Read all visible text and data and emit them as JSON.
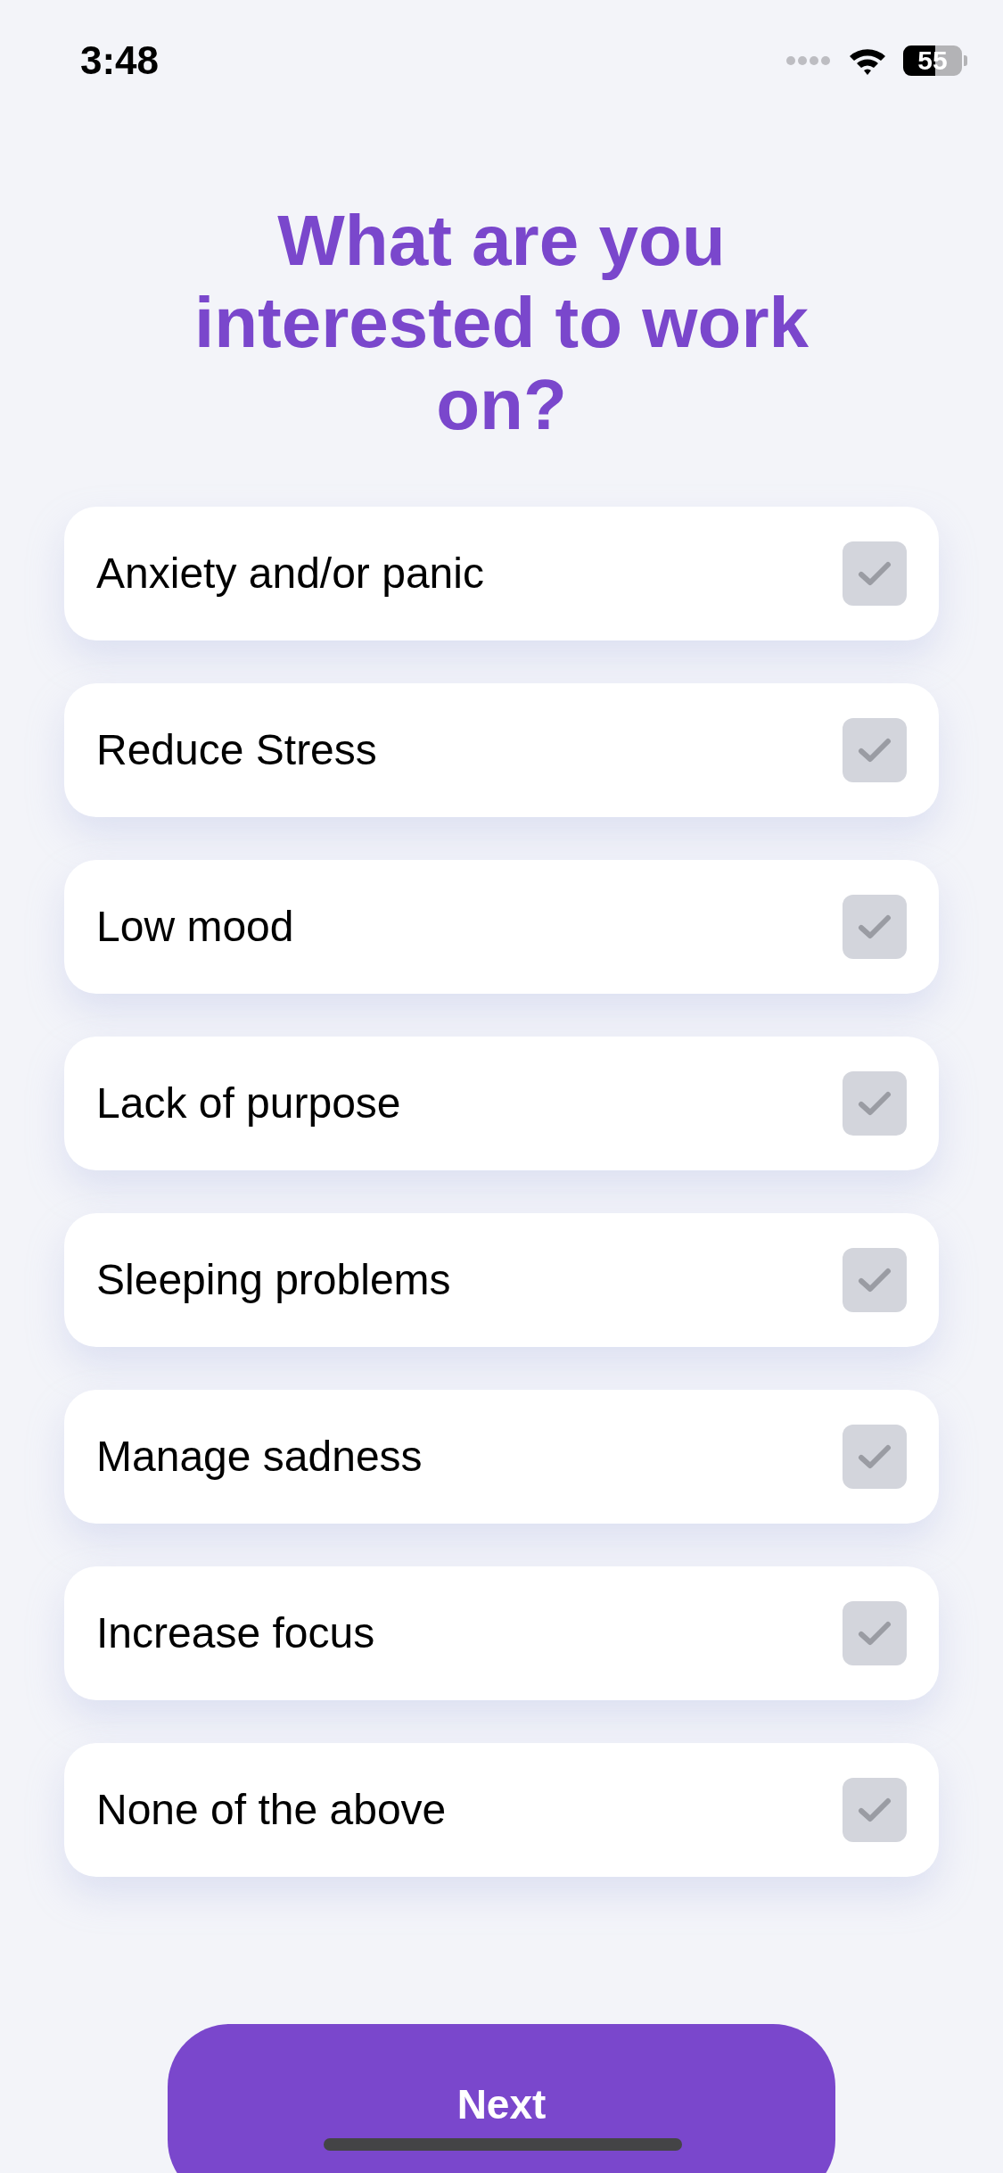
{
  "status_bar": {
    "time": "3:48",
    "battery": "55"
  },
  "title": "What are you interested to work on?",
  "options": [
    {
      "label": "Anxiety and/or panic",
      "checked": false
    },
    {
      "label": "Reduce Stress",
      "checked": false
    },
    {
      "label": "Low mood",
      "checked": false
    },
    {
      "label": "Lack of purpose",
      "checked": false
    },
    {
      "label": "Sleeping problems",
      "checked": false
    },
    {
      "label": "Manage sadness",
      "checked": false
    },
    {
      "label": "Increase focus",
      "checked": false
    },
    {
      "label": "None of the above",
      "checked": false
    }
  ],
  "button": "Next"
}
